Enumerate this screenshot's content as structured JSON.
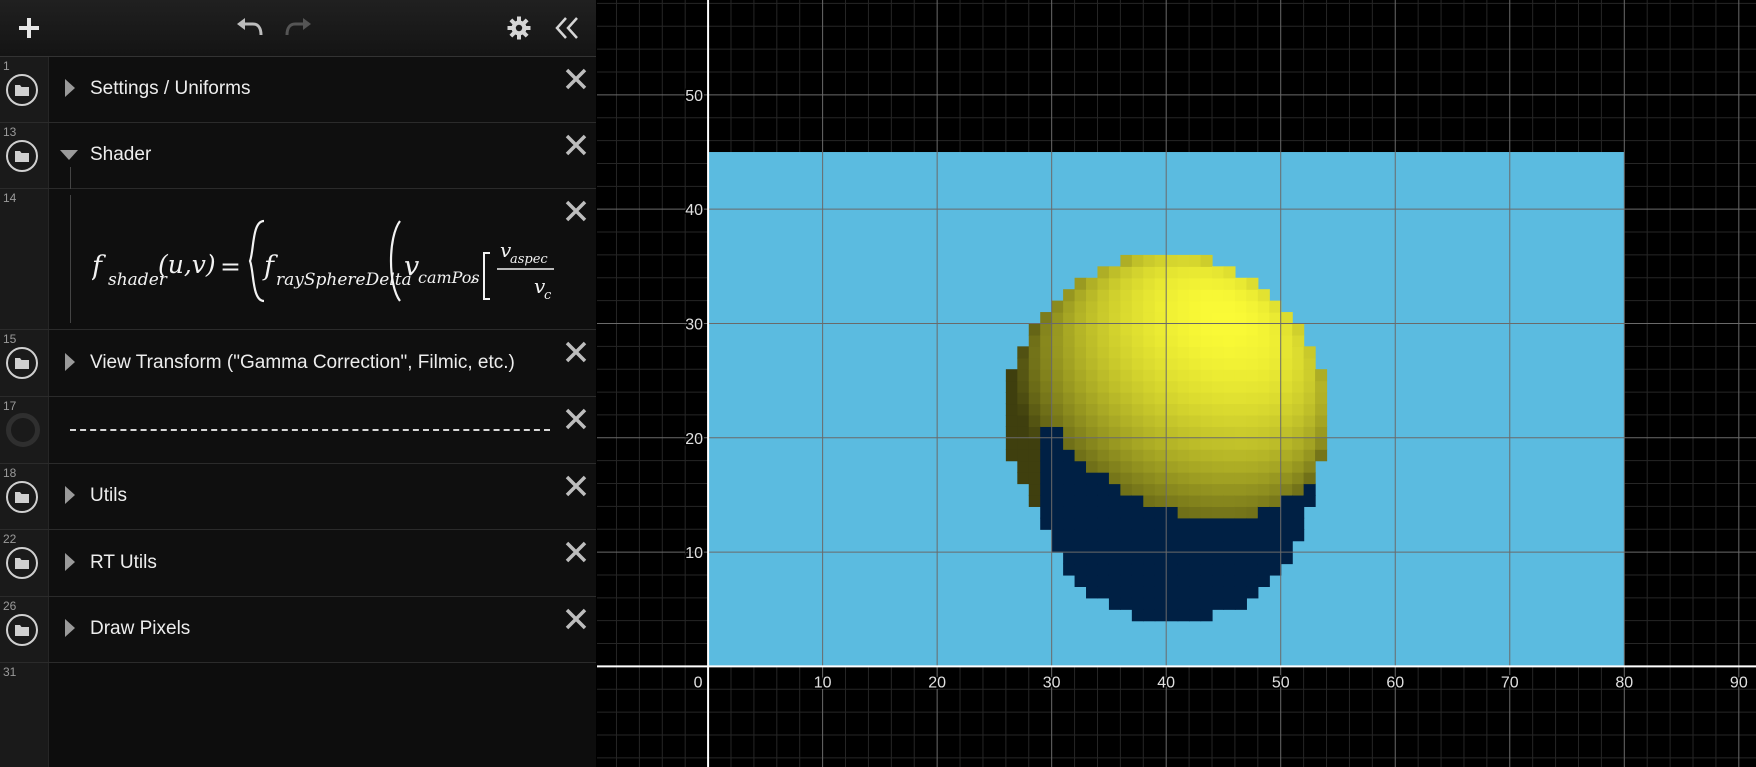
{
  "toolbar": {
    "add_icon": "plus-icon",
    "undo_icon": "undo-icon",
    "redo_icon": "redo-icon",
    "settings_icon": "gear-icon",
    "collapse_icon": "double-chevron-left-icon"
  },
  "expressions": [
    {
      "line": "1",
      "type": "folder",
      "label": "Settings / Uniforms",
      "collapsed": true
    },
    {
      "line": "13",
      "type": "folder",
      "label": "Shader",
      "collapsed": false
    },
    {
      "line": "14",
      "type": "formula",
      "formula": {
        "lhs_f": "f",
        "lhs_sub": "shader",
        "lhs_args": "(u,v)",
        "equals": "=",
        "rhs_f": "f",
        "rhs_sub": "raySphereDelta",
        "arg_v": "v",
        "arg_v_sub": "camPos",
        "comma": ",",
        "frac_num": "v",
        "frac_num_sub": "aspec",
        "frac_den": "v",
        "frac_den_sub": "c"
      }
    },
    {
      "line": "15",
      "type": "folder",
      "label": "View Transform (\"Gamma Correction\", Filmic, etc.)",
      "collapsed": true
    },
    {
      "line": "17",
      "type": "hidden-expression"
    },
    {
      "line": "18",
      "type": "folder",
      "label": "Utils",
      "collapsed": true
    },
    {
      "line": "22",
      "type": "folder",
      "label": "RT Utils",
      "collapsed": true
    },
    {
      "line": "26",
      "type": "folder",
      "label": "Draw Pixels",
      "collapsed": true
    },
    {
      "line": "31",
      "type": "empty"
    }
  ],
  "graph": {
    "background": "#000000",
    "minor_grid_color": "#262626",
    "major_grid_color": "#6a6a6a",
    "axis_color": "#ffffff",
    "x_axis": {
      "min": -9.7,
      "max": 91.5,
      "major_step": 10,
      "minor_step": 2,
      "tick_labels": [
        "0",
        "10",
        "20",
        "30",
        "40",
        "50",
        "60",
        "70",
        "80",
        "90"
      ]
    },
    "y_axis": {
      "min": -8.8,
      "max": 58.3,
      "major_step": 10,
      "minor_step": 2,
      "tick_labels": [
        "10",
        "20",
        "30",
        "40",
        "50"
      ]
    },
    "render": {
      "canvas_x": [
        0,
        80
      ],
      "canvas_y": [
        0,
        45
      ],
      "sky_color": "#5bbbe0",
      "shadow_color": "#002044",
      "sphere_color": "#fafa3c",
      "sphere_center": [
        40,
        22
      ],
      "sphere_radius": 14,
      "light_dir": [
        0.35,
        0.6,
        0.7
      ],
      "shadow_offset": [
        1.5,
        -6
      ],
      "pixel_size": 1
    }
  }
}
